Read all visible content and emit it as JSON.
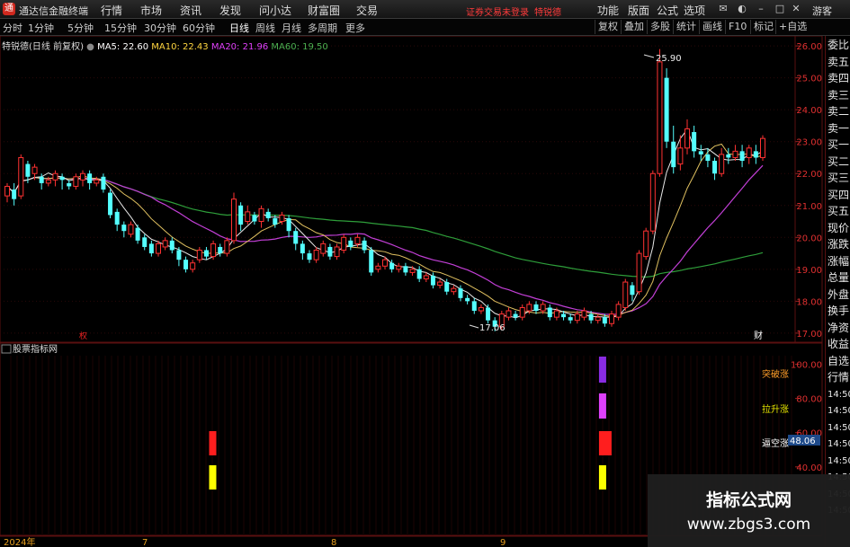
{
  "app": {
    "title": "通达信金融终端",
    "menu": [
      "行情",
      "市场",
      "资讯",
      "发现",
      "问小达",
      "财富圈",
      "交易"
    ],
    "login_status": "证券交易未登录",
    "stock_name": "特锐德",
    "right_menu": [
      "功能",
      "版面",
      "公式",
      "选项"
    ],
    "guest": "游客",
    "window_icons": [
      "msg-icon",
      "skin-icon",
      "minimize-icon",
      "maximize-icon",
      "close-icon"
    ]
  },
  "toolbar": {
    "periods": [
      "分时",
      "1分钟",
      "5分钟",
      "15分钟",
      "30分钟",
      "60分钟",
      "日线",
      "周线",
      "月线",
      "多周期",
      "更多"
    ],
    "active_period": "日线",
    "buttons": [
      "复权",
      "叠加",
      "多股",
      "统计",
      "画线",
      "F10",
      "标记",
      "+自选",
      "返回"
    ]
  },
  "main_chart": {
    "title": "特锐德(日线 前复权)",
    "ma": [
      {
        "label": "MA5: 22.60",
        "color": "#ffffff"
      },
      {
        "label": "MA10: 22.43",
        "color": "#ffd740"
      },
      {
        "label": "MA20: 21.96",
        "color": "#e040fb"
      },
      {
        "label": "MA60: 19.50",
        "color": "#4caf50"
      }
    ],
    "price_ticks": [
      "26.00",
      "25.00",
      "24.00",
      "23.00",
      "22.00",
      "21.00",
      "20.00",
      "19.00",
      "18.00",
      "17.00"
    ],
    "high_label": "25.90",
    "low_label": "17.06",
    "finance_marker": "财",
    "rights_marker": "权"
  },
  "indicator": {
    "title": "股票指标网",
    "ticks": [
      "100.00",
      "80.00",
      "60.00",
      "40.00"
    ],
    "labels": [
      "突破涨",
      "拉升涨",
      "逼空涨"
    ],
    "current_value": "48.06"
  },
  "date_axis": [
    "2024年",
    "7",
    "8",
    "9"
  ],
  "right_panel": [
    "委比",
    "卖五",
    "卖四",
    "卖三",
    "卖二",
    "卖一",
    "买一",
    "买二",
    "买三",
    "买四",
    "买五",
    "现价",
    "涨跌",
    "涨幅",
    "总量",
    "外盘",
    "换手",
    "净资",
    "收益",
    "自选",
    "行情",
    "14:50",
    "14:50",
    "14:50",
    "14:50",
    "14:50",
    "14:50",
    "14:50",
    "14:50"
  ],
  "watermark": {
    "title": "指标公式网",
    "url": "www.zbgs3.com"
  },
  "chart_data": {
    "type": "candlestick",
    "y_range": [
      16.8,
      26.2
    ],
    "candles": [
      [
        21.3,
        21.6,
        21.1,
        21.7
      ],
      [
        21.5,
        21.2,
        21.0,
        21.7
      ],
      [
        21.3,
        22.5,
        21.2,
        22.6
      ],
      [
        22.3,
        21.9,
        21.7,
        22.4
      ],
      [
        22.0,
        22.2,
        21.8,
        22.3
      ],
      [
        21.9,
        21.7,
        21.5,
        22.0
      ],
      [
        21.7,
        21.8,
        21.6,
        21.9
      ],
      [
        21.8,
        22.0,
        21.6,
        22.1
      ],
      [
        21.9,
        21.8,
        21.5,
        22.0
      ],
      [
        21.7,
        21.6,
        21.5,
        21.8
      ],
      [
        21.6,
        21.9,
        21.5,
        22.0
      ],
      [
        21.8,
        22.0,
        21.6,
        22.1
      ],
      [
        22.0,
        21.7,
        21.5,
        22.1
      ],
      [
        21.7,
        21.8,
        21.6,
        21.9
      ],
      [
        21.9,
        21.5,
        21.4,
        22.0
      ],
      [
        21.4,
        20.7,
        20.6,
        21.5
      ],
      [
        20.8,
        20.4,
        20.2,
        20.9
      ],
      [
        20.4,
        20.2,
        20.0,
        20.5
      ],
      [
        20.1,
        20.4,
        20.0,
        20.5
      ],
      [
        20.3,
        19.9,
        19.8,
        20.4
      ],
      [
        20.0,
        19.7,
        19.6,
        20.1
      ],
      [
        19.8,
        19.5,
        19.4,
        19.9
      ],
      [
        19.5,
        19.8,
        19.4,
        19.9
      ],
      [
        19.7,
        19.9,
        19.6,
        20.0
      ],
      [
        19.9,
        19.6,
        19.5,
        20.0
      ],
      [
        19.6,
        19.3,
        19.1,
        19.7
      ],
      [
        19.3,
        19.0,
        18.9,
        19.4
      ],
      [
        19.0,
        19.2,
        18.9,
        19.3
      ],
      [
        19.3,
        19.6,
        19.2,
        19.7
      ],
      [
        19.6,
        19.4,
        19.3,
        19.7
      ],
      [
        19.4,
        19.8,
        19.3,
        19.9
      ],
      [
        19.7,
        19.5,
        19.4,
        19.8
      ],
      [
        19.5,
        19.9,
        19.4,
        20.0
      ],
      [
        19.9,
        21.2,
        19.8,
        21.4
      ],
      [
        21.0,
        20.4,
        20.2,
        21.1
      ],
      [
        20.5,
        20.8,
        20.4,
        21.0
      ],
      [
        20.7,
        20.5,
        20.4,
        20.8
      ],
      [
        20.5,
        20.9,
        20.3,
        21.0
      ],
      [
        20.8,
        20.6,
        20.5,
        20.9
      ],
      [
        20.6,
        20.4,
        20.3,
        20.7
      ],
      [
        20.5,
        20.7,
        20.4,
        20.8
      ],
      [
        20.6,
        20.2,
        20.0,
        20.7
      ],
      [
        20.2,
        19.8,
        19.6,
        20.3
      ],
      [
        19.8,
        19.5,
        19.3,
        19.9
      ],
      [
        19.5,
        19.3,
        19.2,
        19.6
      ],
      [
        19.3,
        19.6,
        19.2,
        19.7
      ],
      [
        19.5,
        19.8,
        19.4,
        19.9
      ],
      [
        19.7,
        19.4,
        19.3,
        19.8
      ],
      [
        19.4,
        19.7,
        19.3,
        19.8
      ],
      [
        19.6,
        20.0,
        19.5,
        20.1
      ],
      [
        19.9,
        19.7,
        19.6,
        20.0
      ],
      [
        19.8,
        20.0,
        19.7,
        20.1
      ],
      [
        19.9,
        19.6,
        19.5,
        20.0
      ],
      [
        19.6,
        18.9,
        18.8,
        19.7
      ],
      [
        19.0,
        19.1,
        18.9,
        19.2
      ],
      [
        19.1,
        19.3,
        19.0,
        19.4
      ],
      [
        19.2,
        19.0,
        18.9,
        19.3
      ],
      [
        19.0,
        19.1,
        18.9,
        19.2
      ],
      [
        19.1,
        18.9,
        18.8,
        19.2
      ],
      [
        18.9,
        19.0,
        18.8,
        19.1
      ],
      [
        19.0,
        18.7,
        18.6,
        19.1
      ],
      [
        18.7,
        18.8,
        18.6,
        18.9
      ],
      [
        18.8,
        18.5,
        18.4,
        18.9
      ],
      [
        18.5,
        18.6,
        18.4,
        18.7
      ],
      [
        18.6,
        18.3,
        18.2,
        18.7
      ],
      [
        18.3,
        18.4,
        18.2,
        18.5
      ],
      [
        18.4,
        18.1,
        18.0,
        18.5
      ],
      [
        18.1,
        18.0,
        17.9,
        18.2
      ],
      [
        18.0,
        17.7,
        17.6,
        18.1
      ],
      [
        17.7,
        17.8,
        17.6,
        17.9
      ],
      [
        17.8,
        17.4,
        17.3,
        17.9
      ],
      [
        17.4,
        17.2,
        17.06,
        17.5
      ],
      [
        17.2,
        17.6,
        17.1,
        17.7
      ],
      [
        17.5,
        17.7,
        17.4,
        17.8
      ],
      [
        17.6,
        17.5,
        17.4,
        17.7
      ],
      [
        17.5,
        17.8,
        17.4,
        17.9
      ],
      [
        17.7,
        17.9,
        17.6,
        18.0
      ],
      [
        17.9,
        17.7,
        17.6,
        18.0
      ],
      [
        17.7,
        17.9,
        17.6,
        18.0
      ],
      [
        17.8,
        17.5,
        17.4,
        17.9
      ],
      [
        17.5,
        17.7,
        17.4,
        17.8
      ],
      [
        17.6,
        17.5,
        17.4,
        17.7
      ],
      [
        17.5,
        17.4,
        17.3,
        17.6
      ],
      [
        17.4,
        17.6,
        17.3,
        17.7
      ],
      [
        17.5,
        17.7,
        17.4,
        17.8
      ],
      [
        17.6,
        17.4,
        17.3,
        17.7
      ],
      [
        17.4,
        17.5,
        17.3,
        17.6
      ],
      [
        17.5,
        17.3,
        17.2,
        17.6
      ],
      [
        17.3,
        17.6,
        17.2,
        17.7
      ],
      [
        17.5,
        17.9,
        17.4,
        18.0
      ],
      [
        17.8,
        18.6,
        17.7,
        18.7
      ],
      [
        18.5,
        18.2,
        18.0,
        18.6
      ],
      [
        18.3,
        19.5,
        18.2,
        19.6
      ],
      [
        19.4,
        20.2,
        19.3,
        20.3
      ],
      [
        20.2,
        22.0,
        20.1,
        22.1
      ],
      [
        22.0,
        25.5,
        21.9,
        25.9
      ],
      [
        25.0,
        23.0,
        22.8,
        25.3
      ],
      [
        23.0,
        22.2,
        22.0,
        23.5
      ],
      [
        22.3,
        22.8,
        22.1,
        23.2
      ],
      [
        22.8,
        23.4,
        22.6,
        23.7
      ],
      [
        23.3,
        22.7,
        22.5,
        23.5
      ],
      [
        22.7,
        22.6,
        22.4,
        22.9
      ],
      [
        22.6,
        22.4,
        22.2,
        22.8
      ],
      [
        22.4,
        22.0,
        21.8,
        22.5
      ],
      [
        22.0,
        22.6,
        21.9,
        22.8
      ],
      [
        22.6,
        22.5,
        22.3,
        22.8
      ],
      [
        22.5,
        22.7,
        22.4,
        22.9
      ],
      [
        22.7,
        22.4,
        22.2,
        22.9
      ],
      [
        22.5,
        22.8,
        22.3,
        22.9
      ],
      [
        22.7,
        22.5,
        22.3,
        22.9
      ],
      [
        22.5,
        23.1,
        22.4,
        23.2
      ]
    ],
    "indicator_bars": [
      {
        "index": 0.272,
        "level": "pullup",
        "color": "#ff1e1e"
      },
      {
        "index": 0.272,
        "level": "squeeze",
        "color": "#ffff00"
      },
      {
        "index": 0.788,
        "level": "breakout",
        "color": "#8a2be2"
      },
      {
        "index": 0.788,
        "level": "rise",
        "color": "#e040fb"
      },
      {
        "index": 0.788,
        "level": "pullup",
        "color": "#ff1e1e"
      },
      {
        "index": 0.788,
        "level": "squeeze",
        "color": "#ffff00"
      }
    ]
  }
}
